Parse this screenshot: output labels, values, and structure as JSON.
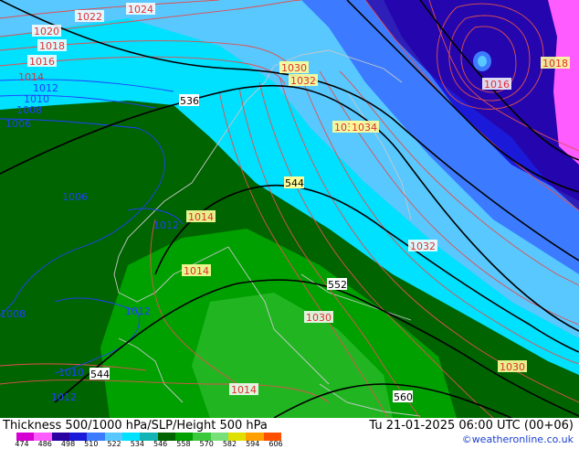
{
  "title": "Thickness 500/1000 hPa/SLP/Height 500 hPa",
  "valid_time": "Tu 21-01-2025 06:00 UTC (00+06)",
  "credit": "©weatheronline.co.uk",
  "colorbar": {
    "ticks": [
      "474",
      "486",
      "498",
      "510",
      "522",
      "534",
      "546",
      "558",
      "570",
      "582",
      "594",
      "606"
    ],
    "colors": [
      "#d400d4",
      "#ff5cff",
      "#2a00a0",
      "#1a1ad8",
      "#3c7bff",
      "#58c8ff",
      "#00e0ff",
      "#14b4b4",
      "#006400",
      "#00a000",
      "#3cc83c",
      "#78e078",
      "#e0e000",
      "#ffa000",
      "#ff5000"
    ]
  },
  "isobars": [
    {
      "text": "1024"
    },
    {
      "text": "1022"
    },
    {
      "text": "1020"
    },
    {
      "text": "1018"
    },
    {
      "text": "1016"
    },
    {
      "text": "1014"
    },
    {
      "text": "1012"
    },
    {
      "text": "1010"
    },
    {
      "text": "1008"
    },
    {
      "text": "1006"
    },
    {
      "text": "1006"
    },
    {
      "text": "1008"
    },
    {
      "text": "1012"
    },
    {
      "text": "1010"
    },
    {
      "text": "1012"
    },
    {
      "text": "1012"
    },
    {
      "text": "1014"
    },
    {
      "text": "1014"
    },
    {
      "text": "1014"
    },
    {
      "text": "1030"
    },
    {
      "text": "1032"
    },
    {
      "text": "1034"
    },
    {
      "text": "1034"
    },
    {
      "text": "1032"
    },
    {
      "text": "1030"
    },
    {
      "text": "1030"
    },
    {
      "text": "1016"
    },
    {
      "text": "1018"
    }
  ],
  "height_labels": [
    {
      "text": "536"
    },
    {
      "text": "544"
    },
    {
      "text": "552"
    },
    {
      "text": "544"
    },
    {
      "text": "560"
    }
  ]
}
